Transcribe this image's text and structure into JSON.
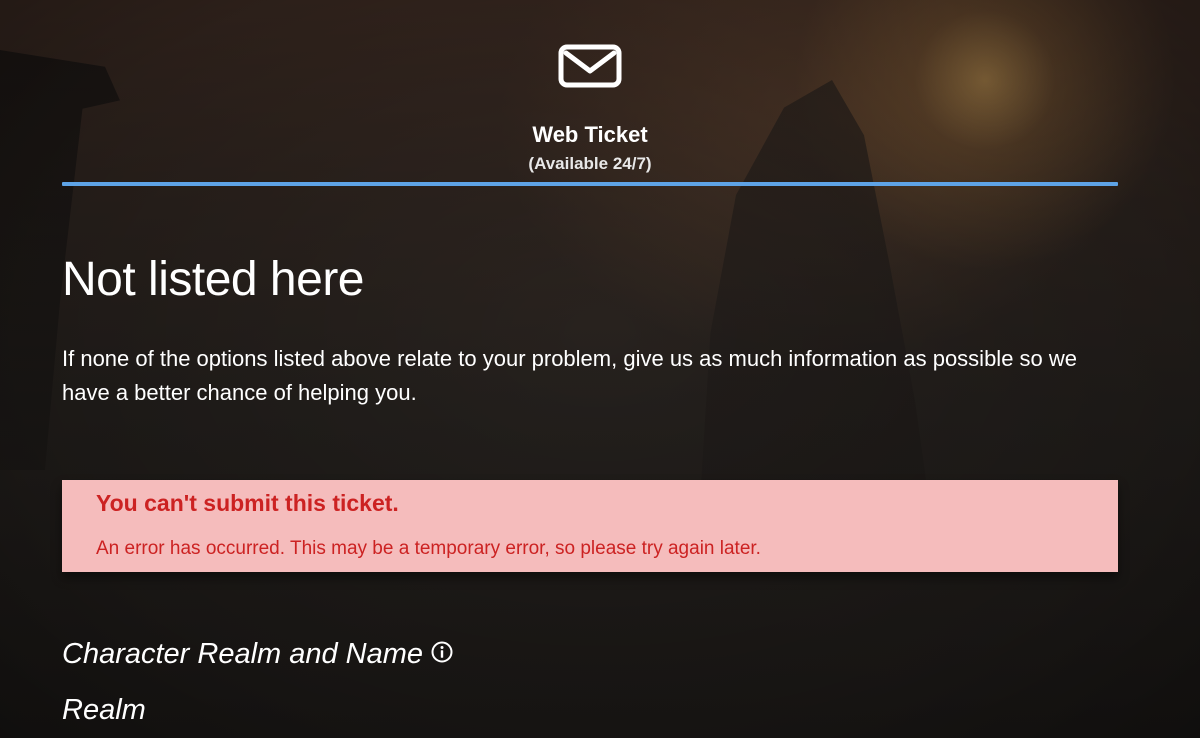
{
  "header": {
    "icon": "mail-icon",
    "title": "Web Ticket",
    "subtitle": "(Available 24/7)",
    "accent_color": "#5ea3e6"
  },
  "section": {
    "heading": "Not listed here",
    "description": "If none of the options listed above relate to your problem, give us as much information as possible so we have a better chance of helping you."
  },
  "error": {
    "title": "You can't submit this ticket.",
    "message": "An error has occurred. This may be a temporary error, so please try again later.",
    "background_color": "#f5bcbc",
    "text_color": "#cc2222"
  },
  "form": {
    "character_label": "Character Realm and Name",
    "character_info_icon": "info-icon",
    "realm_label": "Realm"
  }
}
